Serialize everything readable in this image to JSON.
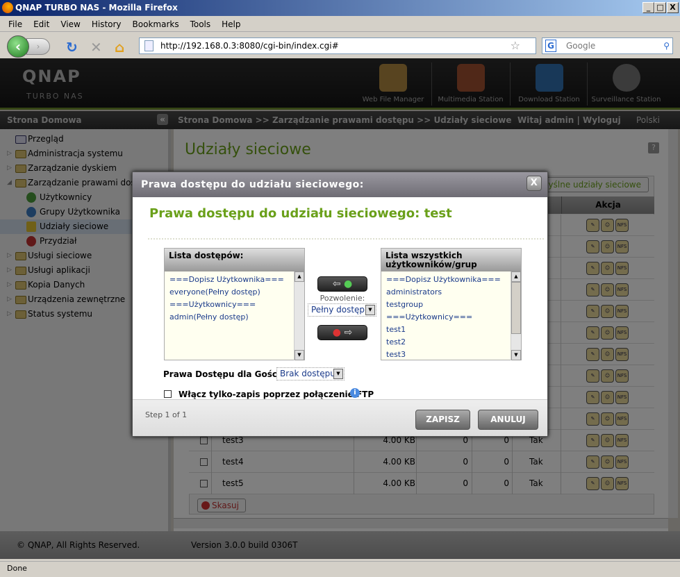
{
  "browser": {
    "title": "QNAP TURBO NAS - Mozilla Firefox",
    "menu": [
      "File",
      "Edit",
      "View",
      "History",
      "Bookmarks",
      "Tools",
      "Help"
    ],
    "url": "http://192.168.0.3:8080/cgi-bin/index.cgi#",
    "search_placeholder": "Google",
    "status": "Done"
  },
  "header": {
    "logo": "QNAP",
    "logo_sub": "TURBO NAS",
    "apps": [
      "Web File Manager",
      "Multimedia Station",
      "Download Station",
      "Surveillance Station"
    ]
  },
  "crumbs": {
    "home": "Strona Domowa",
    "path": "Strona Domowa >> Zarządzanie prawami dostępu >> Udziały sieciowe",
    "welcome": "Witaj admin | Wyloguj",
    "language": "Polski"
  },
  "sidebar": {
    "items": [
      {
        "label": "Przegląd"
      },
      {
        "label": "Administracja systemu"
      },
      {
        "label": "Zarządzanie dyskiem"
      },
      {
        "label": "Zarządzanie prawami dostępu"
      },
      {
        "label": "Użytkownicy"
      },
      {
        "label": "Grupy Użytkownika"
      },
      {
        "label": "Udziały sieciowe"
      },
      {
        "label": "Przydział"
      },
      {
        "label": "Usługi sieciowe"
      },
      {
        "label": "Usługi aplikacji"
      },
      {
        "label": "Kopia Danych"
      },
      {
        "label": "Urządzenia zewnętrzne"
      },
      {
        "label": "Status systemu"
      }
    ]
  },
  "main": {
    "title": "Udziały sieciowe",
    "default_shares_button": "yślne udziały sieciowe",
    "action_header": "Akcja",
    "delete_button": "Skasuj",
    "rows": [
      {
        "name": "test3",
        "size": "4.00 KB",
        "a": "0",
        "b": "0",
        "c": "Tak"
      },
      {
        "name": "test4",
        "size": "4.00 KB",
        "a": "0",
        "b": "0",
        "c": "Tak"
      },
      {
        "name": "test5",
        "size": "4.00 KB",
        "a": "0",
        "b": "0",
        "c": "Tak"
      }
    ],
    "action_icons": [
      "edit-icon",
      "permission-icon",
      "nfs-icon"
    ],
    "nfs_label": "NFS"
  },
  "footer": {
    "copyright": "© QNAP, All Rights Reserved.",
    "version": "Version 3.0.0 build 0306T"
  },
  "dialog": {
    "header": "Prawa dostępu do udziału sieciowego:",
    "close": "X",
    "title": "Prawa dostępu do udziału sieciowego: test",
    "access_list": {
      "label": "Lista dostępów:",
      "items": [
        "===Dopisz Użytkownika===",
        "everyone(Pełny dostęp)",
        "===Użytkownicy===",
        "admin(Pełny dostęp)"
      ]
    },
    "all_list": {
      "label": "Lista wszystkich użytkowników/grup",
      "items": [
        "===Dopisz Użytkownika===",
        "administrators",
        "testgroup",
        "===Użytkownicy===",
        "test1",
        "test2",
        "test3"
      ]
    },
    "permission_label": "Pozwolenie:",
    "permission_value": "Pełny dostęp",
    "guest_label": "Prawa Dostępu dla Gościa:",
    "guest_value": "Brak dostępu",
    "ftp_label": "Włącz tylko-zapis poprzez połączenie FTP",
    "ftp_checked": false,
    "step": "Step 1 of 1",
    "save": "ZAPISZ",
    "cancel": "ANULUJ"
  },
  "colors": {
    "accent": "#6aa01a",
    "link": "#1a3a8a"
  }
}
